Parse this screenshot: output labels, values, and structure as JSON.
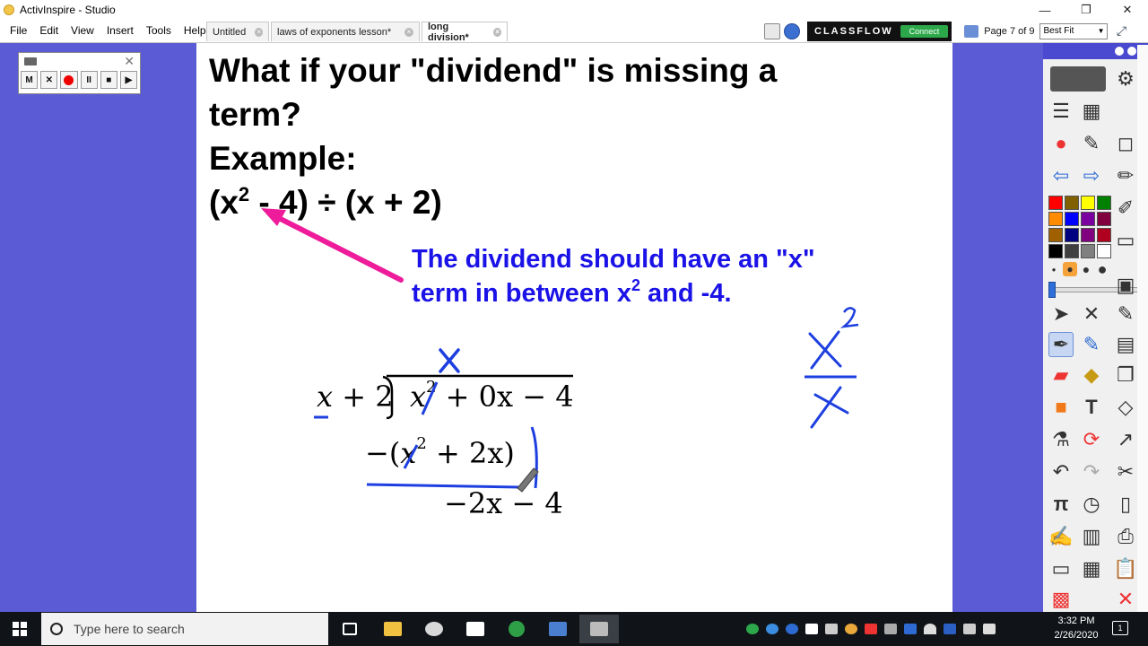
{
  "window": {
    "title": "ActivInspire - Studio",
    "minimize": "—",
    "maximize": "❐",
    "close": "✕"
  },
  "menu": [
    "File",
    "Edit",
    "View",
    "Insert",
    "Tools",
    "Help"
  ],
  "tabs": [
    {
      "label": "Untitled",
      "close": "×"
    },
    {
      "label": "laws of exponents lesson*",
      "close": "×"
    },
    {
      "label": "long division*",
      "close": "×"
    }
  ],
  "classflow": {
    "label": "CLASSFLOW",
    "connect": "Connect"
  },
  "page_indicator": "Page 7 of 9",
  "zoom": {
    "value": "Best Fit",
    "arrow": "▼"
  },
  "fit_icon": "⤢",
  "recorder": {
    "m": "M",
    "x": "✕",
    "pause": "II",
    "stop": "■",
    "play": "▶",
    "close": "✕"
  },
  "slide": {
    "line1": "What if your \"dividend\" is missing a",
    "line2": "term?",
    "line3": "Example:",
    "expr_a": "(x",
    "expr_exp": "2",
    "expr_b": " - 4) ÷ (x + 2)",
    "note_line1": "The dividend should have an \"x\"",
    "note_line2a": "term in between x",
    "note_exp": "2",
    "note_line2b": " and -4.",
    "divisor": "x",
    "divisor_rest": " + 2",
    "dividend_x": "x",
    "dividend_exp": "2",
    "dividend_rest": " + 0x − 4",
    "subtract_open": "−(",
    "subtract_x": "x",
    "subtract_exp": "2",
    "subtract_rest": " + 2x)",
    "remainder": "−2x − 4"
  },
  "colors": {
    "background": "#5b5bd6",
    "note_blue": "#1a12e6",
    "ink_blue": "#1d3fe0",
    "arrow_pink": "#ee1c9a",
    "classflow_green": "#2ca84a"
  },
  "toolbox_swatches": [
    "#ff0000",
    "#806000",
    "#ffff00",
    "#008000",
    "#ff8c00",
    "#0000ff",
    "#7a00a0",
    "#800040",
    "#a06000",
    "#000080",
    "#800080",
    "#b00020",
    "#000000",
    "#404040",
    "#808080",
    "#ffffff"
  ],
  "taskbar": {
    "search_placeholder": "Type here to search",
    "time": "3:32 PM",
    "date": "2/26/2020",
    "notifications": "1"
  }
}
